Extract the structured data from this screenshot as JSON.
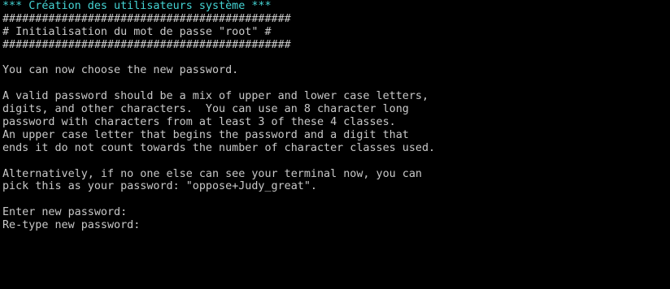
{
  "terminal": {
    "banner": "*** Création des utilisateurs système ***",
    "hash_line_1": "############################################",
    "init_title": "# Initialisation du mot de passe \"root\" #",
    "hash_line_2": "############################################",
    "choose_msg": "You can now choose the new password.",
    "advice_lines": [
      "A valid password should be a mix of upper and lower case letters,",
      "digits, and other characters.  You can use an 8 character long",
      "password with characters from at least 3 of these 4 classes.",
      "An upper case letter that begins the password and a digit that",
      "ends it do not count towards the number of character classes used."
    ],
    "suggest_lines": [
      "Alternatively, if no one else can see your terminal now, you can",
      "pick this as your password: \"oppose+Judy_great\"."
    ],
    "enter_prompt": "Enter new password:",
    "retype_prompt": "Re-type new password:",
    "colors": {
      "background": "#000000",
      "text": "#c9c9c9",
      "banner": "#45d4d4"
    }
  }
}
